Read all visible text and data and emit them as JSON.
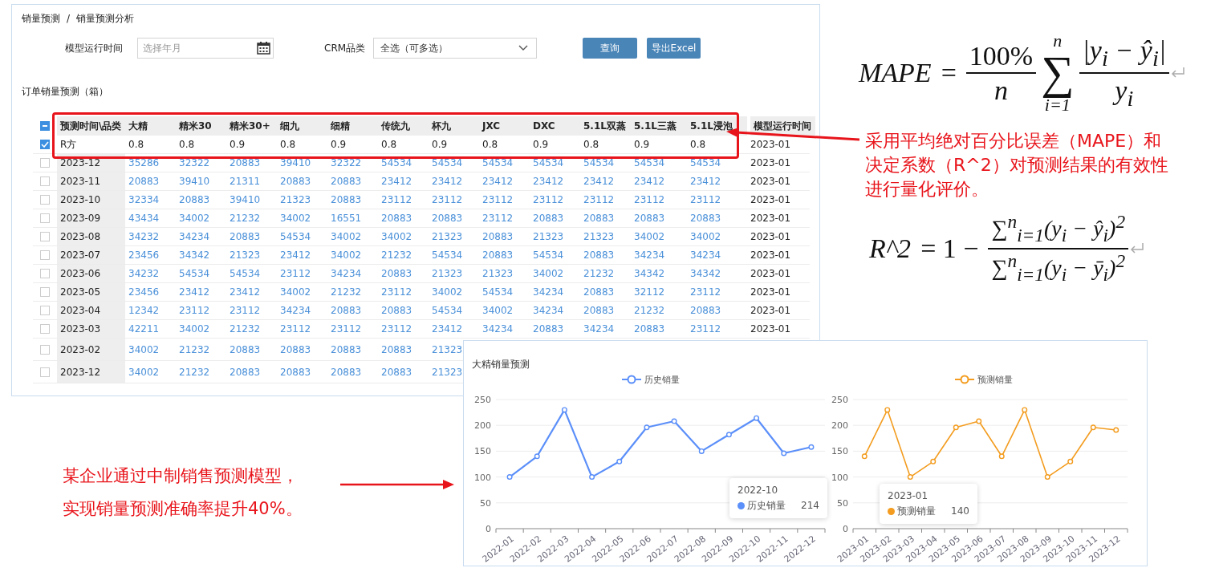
{
  "breadcrumb": {
    "items": [
      "销量预测",
      "销量预测分析"
    ],
    "separator": "/"
  },
  "filters": {
    "time_label": "模型运行时间",
    "time_placeholder": "选择年月",
    "category_label": "CRM品类",
    "category_value": "全选（可多选）",
    "buttons": [
      "查询",
      "导出Excel"
    ]
  },
  "section_title": "订单销量预测（箱）",
  "table": {
    "select_all_partial": true,
    "columns": [
      "预测时间\\品类",
      "大精",
      "精米30",
      "精米30+",
      "细九",
      "细精",
      "传统九",
      "杯九",
      "JXC",
      "DXC",
      "5.1L双蒸",
      "5.1L三蒸",
      "5.1L浸泡",
      "模型运行时间"
    ],
    "rows": [
      {
        "kind": "metric",
        "checked": true,
        "label": "R方",
        "values": [
          "0.8",
          "0.8",
          "0.9",
          "0.8",
          "0.9",
          "0.8",
          "0.9",
          "0.8",
          "0.9",
          "0.8",
          "0.9",
          "0.8"
        ],
        "model_time": "2023-01"
      },
      {
        "kind": "data",
        "checked": false,
        "label": "2023-12",
        "values": [
          "35286",
          "32322",
          "20883",
          "39410",
          "32322",
          "54534",
          "54534",
          "54534",
          "54534",
          "54534",
          "54534",
          "54534"
        ],
        "model_time": "2023-01"
      },
      {
        "kind": "data",
        "checked": false,
        "label": "2023-11",
        "values": [
          "20883",
          "39410",
          "21311",
          "20883",
          "20883",
          "23412",
          "23412",
          "23412",
          "23412",
          "23412",
          "23412",
          "23412"
        ],
        "model_time": "2023-01"
      },
      {
        "kind": "data",
        "checked": false,
        "label": "2023-10",
        "values": [
          "32334",
          "20883",
          "39410",
          "21323",
          "20883",
          "23112",
          "23112",
          "23112",
          "23112",
          "23112",
          "23112",
          "23112"
        ],
        "model_time": "2023-01"
      },
      {
        "kind": "data",
        "checked": false,
        "label": "2023-09",
        "values": [
          "43434",
          "34002",
          "21232",
          "34002",
          "16551",
          "20883",
          "20883",
          "23112",
          "20883",
          "20883",
          "20883",
          "20883"
        ],
        "model_time": "2023-01"
      },
      {
        "kind": "data",
        "checked": false,
        "label": "2023-08",
        "values": [
          "34232",
          "34234",
          "20883",
          "54534",
          "34002",
          "34002",
          "21323",
          "20883",
          "21323",
          "21323",
          "34002",
          "34002"
        ],
        "model_time": "2023-01"
      },
      {
        "kind": "data",
        "checked": false,
        "label": "2023-07",
        "values": [
          "23456",
          "34342",
          "21323",
          "23412",
          "34002",
          "21232",
          "54534",
          "20883",
          "54534",
          "20883",
          "34234",
          "34234"
        ],
        "model_time": "2023-01"
      },
      {
        "kind": "data",
        "checked": false,
        "label": "2023-06",
        "values": [
          "34232",
          "54534",
          "54534",
          "23112",
          "34234",
          "20883",
          "21323",
          "21323",
          "34002",
          "21232",
          "34342",
          "34342"
        ],
        "model_time": "2023-01"
      },
      {
        "kind": "data",
        "checked": false,
        "label": "2023-05",
        "values": [
          "23456",
          "23412",
          "23412",
          "34002",
          "21232",
          "23112",
          "34002",
          "54534",
          "34234",
          "20883",
          "32112",
          "23112"
        ],
        "model_time": "2023-01"
      },
      {
        "kind": "data",
        "checked": false,
        "label": "2023-04",
        "values": [
          "12342",
          "23112",
          "23112",
          "34234",
          "20883",
          "20883",
          "54534",
          "34002",
          "34234",
          "20883",
          "21232",
          "20883"
        ],
        "model_time": "2023-01"
      },
      {
        "kind": "data",
        "checked": false,
        "label": "2023-03",
        "values": [
          "42211",
          "34002",
          "21232",
          "23112",
          "23112",
          "23112",
          "23412",
          "34234",
          "20883",
          "34234",
          "20883",
          "23112"
        ],
        "model_time": "2023-01"
      },
      {
        "kind": "data",
        "checked": false,
        "label": "2023-02",
        "values": [
          "34002",
          "21232",
          "20883",
          "20883",
          "20883",
          "20883",
          "21323"
        ]
      },
      {
        "kind": "data",
        "checked": false,
        "label": "2023-12",
        "values": [
          "34002",
          "21232",
          "20883",
          "20883",
          "20883",
          "20883",
          "21323"
        ]
      }
    ]
  },
  "chart_panel": {
    "title": "大精销量预测",
    "charts": [
      {
        "chart_data": {
          "type": "line",
          "categories": [
            "2022-01",
            "2022-02",
            "2022-03",
            "2022-04",
            "2022-05",
            "2022-06",
            "2022-07",
            "2022-08",
            "2022-09",
            "2022-10",
            "2022-11",
            "2022-12"
          ],
          "series": [
            {
              "name": "历史销量",
              "color": "#5b8ff9",
              "marker": true,
              "values": [
                100,
                140,
                230,
                100,
                130,
                196,
                208,
                150,
                182,
                214,
                146,
                158
              ]
            }
          ],
          "ylim": [
            0,
            250
          ],
          "yticks": [
            0,
            50,
            100,
            150,
            200,
            250
          ],
          "grid": true
        },
        "tooltip": {
          "title": "2022-10",
          "label": "历史销量",
          "value": "214"
        }
      },
      {
        "chart_data": {
          "type": "line",
          "categories": [
            "2023-01",
            "2023-02",
            "2023-03",
            "2023-04",
            "2023-05",
            "2023-06",
            "2023-07",
            "2023-08",
            "2023-09",
            "2023-10",
            "2023-11",
            "2023-12"
          ],
          "series": [
            {
              "name": "预测销量",
              "color": "#f39c1f",
              "marker": true,
              "values": [
                140,
                230,
                100,
                130,
                196,
                208,
                140,
                230,
                100,
                130,
                196,
                191
              ]
            }
          ],
          "ylim": [
            0,
            250
          ],
          "yticks": [
            0,
            50,
            100,
            150,
            200,
            250
          ],
          "grid": true
        },
        "tooltip": {
          "title": "2023-01",
          "label": "预测销量",
          "value": "140"
        }
      }
    ]
  },
  "formulas": {
    "mape": {
      "lhs": "MAPE",
      "equals": "=",
      "coef_num": "100%",
      "coef_den": "n",
      "sum_symbol": "∑",
      "sum_upper": "n",
      "sum_lower": "i=1",
      "frac_num": "|y$_{i}$ − ŷ$_{i}$|",
      "frac_den": "y$_{i}$"
    },
    "r2": {
      "lhs": "R^2",
      "rhs_prefix": "= 1 −",
      "num": "∑$^{n}$$_{i=1}$(y$_{i}$ − ŷ$_{i}$)$^{2}$",
      "den": "∑$^{n}$$_{i=1}$(y$_{i}$ − ȳ$_{i}$)$^{2}$"
    }
  },
  "notes": [
    {
      "lines": [
        "采用平均绝对百分比误差（MAPE）和",
        "决定系数（R^2）对预测结果的有效性",
        "进行量化评价。"
      ]
    },
    {
      "lines": [
        "某企业通过中制销售预测模型，",
        "实现销量预测准确率提升40%。"
      ]
    }
  ]
}
